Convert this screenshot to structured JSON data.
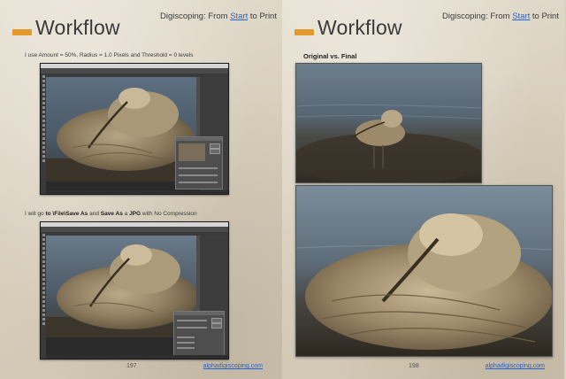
{
  "left_page": {
    "header_title": "Workflow",
    "series_prefix": "Digiscoping: From ",
    "series_link": "Start",
    "series_suffix": " to Print",
    "caption_top": "I use Amount = 50%, Radius = 1.0 Pixels and Threshold = 0 levels",
    "caption_bottom": {
      "part1": "I will go ",
      "bold1": "to \\File\\Save As",
      "part2": " and ",
      "bold2": "Save As",
      "part3": " a ",
      "bold3": "JPG",
      "part4": " with No Compression"
    },
    "page_number": "197",
    "footer_link": "alphadigiscoping.com"
  },
  "right_page": {
    "header_title": "Workflow",
    "series_prefix": "Digiscoping: From ",
    "series_link": "Start",
    "series_suffix": " to Print",
    "caption": "Original vs. Final",
    "page_number": "198",
    "footer_link": "alphadigiscoping.com"
  },
  "colors": {
    "accent_band": "#e09a2d",
    "link": "#2a63c8",
    "paper": "#ddd5c4"
  },
  "icons": [
    "section-marker-icon"
  ]
}
